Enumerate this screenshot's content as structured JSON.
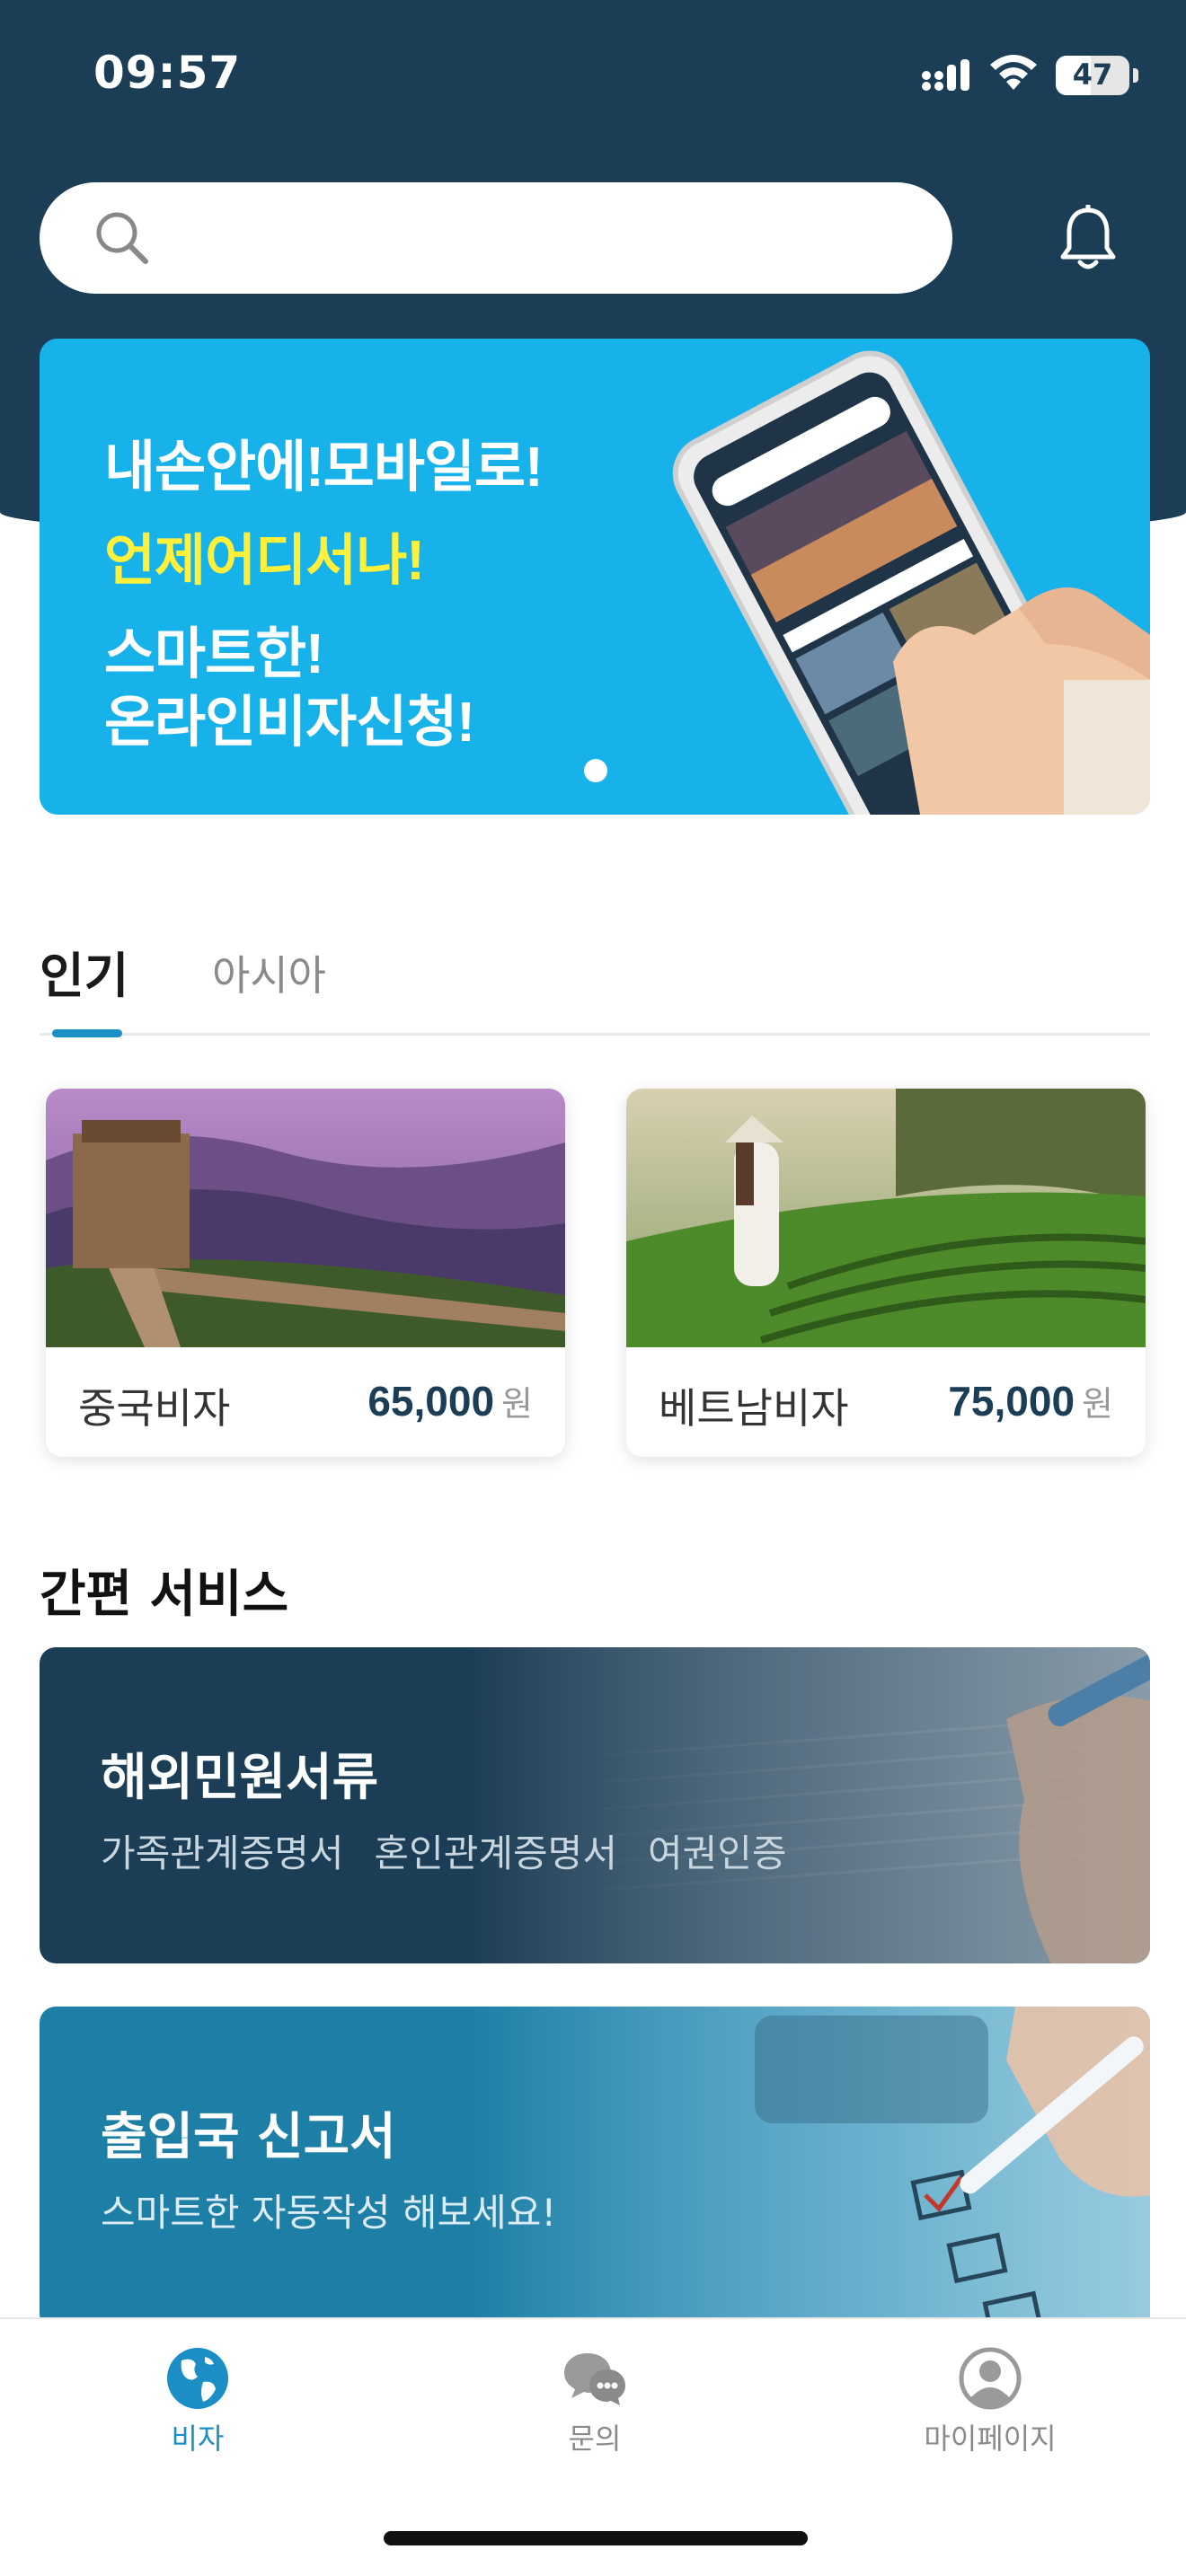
{
  "status_bar": {
    "time": "09:57",
    "battery": "47",
    "battery_fraction": 0.47
  },
  "search": {
    "placeholder": ""
  },
  "banner": {
    "line1": "내손안에!모바일로!",
    "line2": "언제어디서나!",
    "line3": "스마트한!",
    "line4": "온라인비자신청!",
    "accent_color": "#fff03c",
    "background_color": "#17b2ea"
  },
  "tabs": [
    {
      "label": "인기",
      "active": true
    },
    {
      "label": "아시아",
      "active": false
    }
  ],
  "visa_cards": [
    {
      "name": "중국비자",
      "price": "65,000",
      "unit": "원"
    },
    {
      "name": "베트남비자",
      "price": "75,000",
      "unit": "원"
    }
  ],
  "services": {
    "title": "간편 서비스",
    "items": [
      {
        "title": "해외민원서류",
        "tags": [
          "가족관계증명서",
          "혼인관계증명서",
          "여권인증"
        ]
      },
      {
        "title": "출입국 신고서",
        "subtitle": "스마트한 자동작성 해보세요!"
      }
    ]
  },
  "bottom_nav": [
    {
      "label": "비자",
      "icon": "globe-icon",
      "active": true
    },
    {
      "label": "문의",
      "icon": "chat-bubbles-icon",
      "active": false
    },
    {
      "label": "마이페이지",
      "icon": "user-circle-icon",
      "active": false
    }
  ],
  "colors": {
    "primary_dark": "#1b3d55",
    "accent_blue": "#1b8fc5"
  }
}
